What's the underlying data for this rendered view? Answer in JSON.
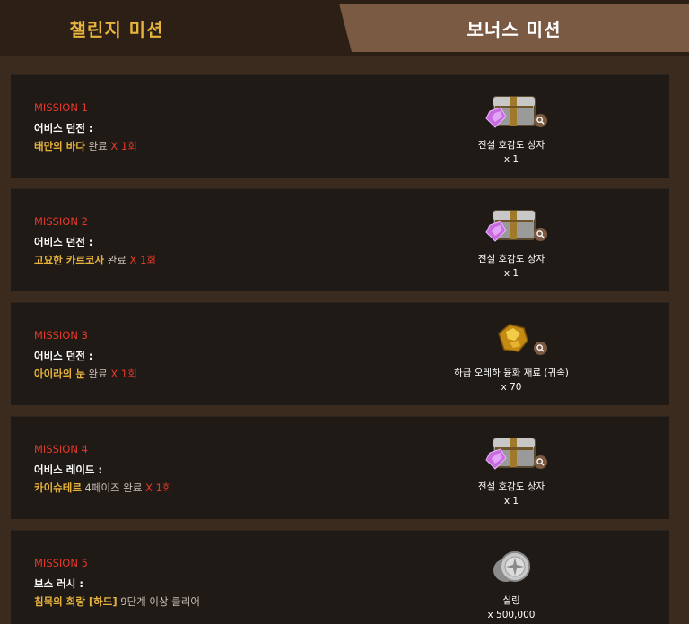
{
  "tabs": {
    "challenge": "챌린지 미션",
    "bonus": "보너스 미션"
  },
  "missions": [
    {
      "label": "MISSION 1",
      "type": "어비스 던전 :",
      "highlight": "태만의 바다",
      "plain": " 완료",
      "count": " X 1회",
      "reward_name": "전설 호감도 상자",
      "reward_qty": "x 1",
      "reward_icon": "chest-icon"
    },
    {
      "label": "MISSION 2",
      "type": "어비스 던전 :",
      "highlight": "고요한 카르코사",
      "plain": " 완료",
      "count": " X 1회",
      "reward_name": "전설 호감도 상자",
      "reward_qty": "x 1",
      "reward_icon": "chest-icon"
    },
    {
      "label": "MISSION 3",
      "type": "어비스 던전 :",
      "highlight": "아이라의 눈",
      "plain": " 완료",
      "count": " X 1회",
      "reward_name": "하급 오레하 융화 재료 (귀속)",
      "reward_qty": "x 70",
      "reward_icon": "ore-icon"
    },
    {
      "label": "MISSION 4",
      "type": "어비스 레이드 :",
      "highlight": "카이슈테르",
      "plain": " 4페이즈 완료",
      "count": " X 1회",
      "reward_name": "전설 호감도 상자",
      "reward_qty": "x 1",
      "reward_icon": "chest-icon"
    },
    {
      "label": "MISSION 5",
      "type": "보스 러시 :",
      "highlight": "침묵의 회랑 [하드]",
      "plain": " 9단계 이상 클리어",
      "count": "",
      "reward_name": "실링",
      "reward_qty": "x 500,000",
      "reward_icon": "silver-coin-icon"
    }
  ],
  "colors": {
    "background": "#3a2a1e",
    "card": "#1f1a16",
    "mission_red": "#e5392b",
    "highlight_gold": "#e8b33c",
    "active_tab": "#7a5a43"
  }
}
